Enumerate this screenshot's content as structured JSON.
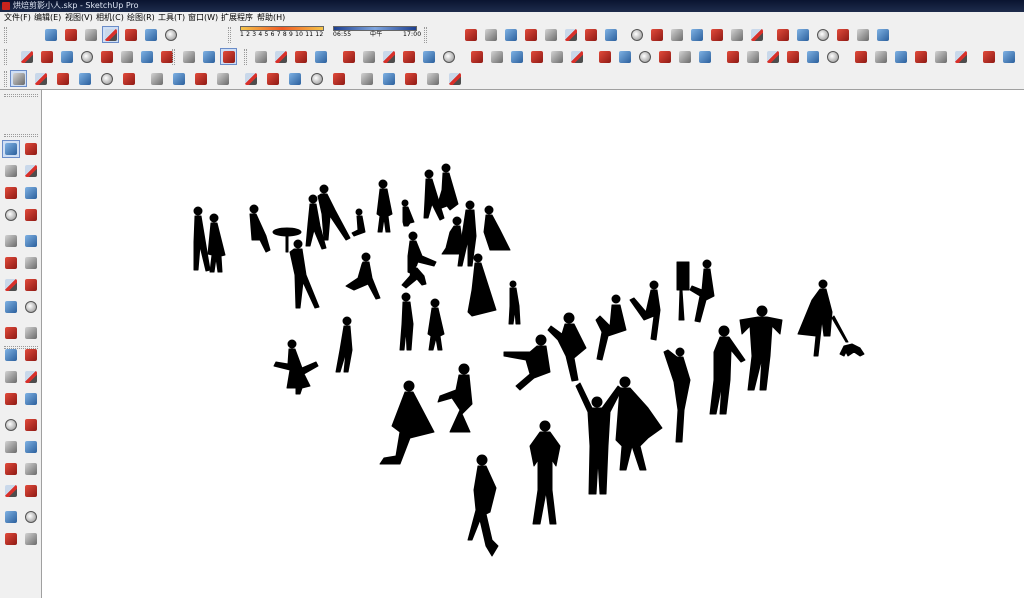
{
  "window": {
    "title": "烘焙剪影小人.skp - SketchUp Pro"
  },
  "menu": {
    "items": [
      "文件(F)",
      "编辑(E)",
      "视图(V)",
      "相机(C)",
      "绘图(R)",
      "工具(T)",
      "窗口(W)",
      "扩展程序",
      "帮助(H)"
    ]
  },
  "shadow_settings": {
    "months": "1 2 3 4 5 6 7 8 9 10 11 12",
    "time_start": "06:55",
    "time_mid": "中午",
    "time_end": "17:00"
  },
  "toolbar_icons": {
    "row1": [
      "gallery-icon",
      "iso-view-icon",
      "top-view-icon",
      "front-view-icon",
      "right-view-icon",
      "back-view-icon",
      "left-view-icon",
      "bottom-view-icon",
      "sandbox-icon",
      "section-icon",
      "dimension-icon",
      "text-icon",
      "axes-icon",
      "3d-text-icon",
      "paint-icon",
      "tape-icon",
      "rotate-icon",
      "orbit-icon",
      "pan-icon",
      "zoom-icon",
      "zoom-window-icon",
      "zoom-extents-icon",
      "position-camera-icon",
      "look-around-icon",
      "walk-icon",
      "section-plane-icon",
      "display-sections-icon",
      "section-cuts-icon"
    ],
    "row2": [
      "xray-icon",
      "back-edges-icon",
      "wireframe-icon",
      "hidden-line-icon",
      "shaded-icon",
      "shaded-texture-icon",
      "monochrome-icon",
      "component-icon",
      "solid-icon",
      "outer-shell-icon",
      "intersect-icon",
      "union-icon",
      "subtract-icon",
      "trim-icon",
      "split-icon"
    ],
    "row3": [
      "select-icon",
      "eraser-icon",
      "line-icon",
      "arc-icon",
      "rectangle-icon",
      "push-pull-icon",
      "move-icon",
      "rotate-tool-icon",
      "scale-icon",
      "offset-icon",
      "tape-measure-icon",
      "text-tool-icon",
      "paint-bucket-icon",
      "orbit-tool-icon",
      "pan-tool-icon",
      "zoom-tool-icon",
      "zoom-extents-tool-icon",
      "warehouse-icon",
      "share-model-icon",
      "extension-warehouse-icon"
    ]
  },
  "left_tools": [
    "select-icon",
    "make-component-icon",
    "paint-bucket-icon",
    "eraser-icon",
    "line-icon",
    "freehand-icon",
    "rectangle-icon",
    "rotated-rectangle-icon",
    "circle-icon",
    "polygon-icon",
    "arc-icon",
    "two-point-arc-icon",
    "three-point-arc-icon",
    "pie-icon",
    "move-icon",
    "push-pull-icon",
    "rotate-icon",
    "follow-me-icon",
    "scale-icon",
    "offset-icon",
    "tape-measure-icon",
    "dimension-icon",
    "protractor-icon",
    "text-icon",
    "axes-icon",
    "3d-text-icon",
    "orbit-icon",
    "pan-icon",
    "zoom-icon",
    "zoom-window-icon",
    "zoom-extents-icon",
    "previous-view-icon",
    "position-camera-icon",
    "look-around-icon",
    "walk-icon",
    "section-plane-icon"
  ]
}
